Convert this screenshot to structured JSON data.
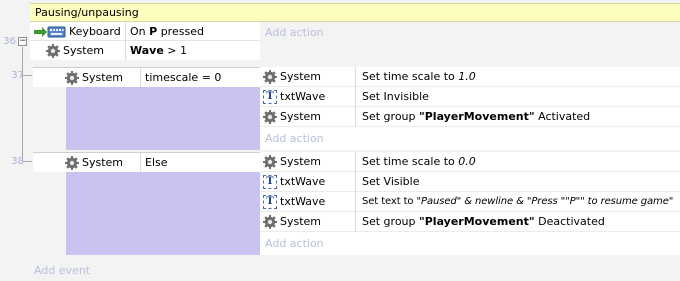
{
  "group": {
    "title": "Pausing/unpausing"
  },
  "events": [
    {
      "number": "36",
      "conditions": [
        {
          "object": "Keyboard",
          "icon": "keyboard-icon",
          "pre": "On ",
          "bold": "P",
          "post": " pressed"
        },
        {
          "object": "System",
          "icon": "gear-icon",
          "pre": "",
          "bold": "Wave",
          "post": " > 1"
        }
      ],
      "add_action": "Add action"
    },
    {
      "number": "37",
      "conditions": [
        {
          "object": "System",
          "icon": "gear-icon",
          "text": "timescale = 0"
        }
      ],
      "actions": [
        {
          "object": "System",
          "icon": "gear-icon",
          "pre": "Set time scale to ",
          "italic": "1.0"
        },
        {
          "object": "txtWave",
          "icon": "text-object-icon",
          "pre": "Set Invisible"
        },
        {
          "object": "System",
          "icon": "gear-icon",
          "pre": "Set group ",
          "bold": "\"PlayerMovement\"",
          "post": " Activated"
        }
      ],
      "add_action": "Add action"
    },
    {
      "number": "38",
      "conditions": [
        {
          "object": "System",
          "icon": "gear-icon",
          "text": "Else"
        }
      ],
      "actions": [
        {
          "object": "System",
          "icon": "gear-icon",
          "pre": "Set time scale to ",
          "italic": "0.0"
        },
        {
          "object": "txtWave",
          "icon": "text-object-icon",
          "pre": "Set Visible"
        },
        {
          "object": "txtWave",
          "icon": "text-object-icon",
          "pre": "Set text to ",
          "italic": "\"Paused\" & newline & \"Press \"\"P\"\" to resume game\""
        },
        {
          "object": "System",
          "icon": "gear-icon",
          "pre": "Set group ",
          "bold": "\"PlayerMovement\"",
          "post": " Deactivated"
        }
      ],
      "add_action": "Add action"
    }
  ],
  "add_event": "Add event",
  "collapse_symbol": "−"
}
